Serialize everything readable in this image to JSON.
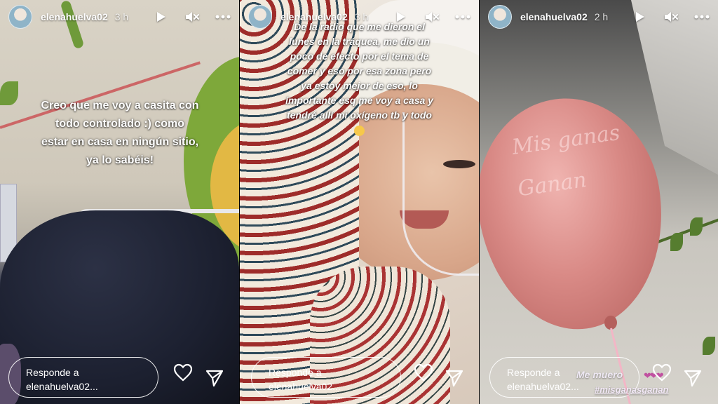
{
  "stories": [
    {
      "username": "elenahuelva02",
      "time": "3 h",
      "caption": "Creo que me voy a casita con\ntodo controlado :) como\nestar en casa en ningún sitio,\nya lo sabéis!",
      "reply_line1": "Responde a",
      "reply_line2": "elenahuelva02..."
    },
    {
      "username": "elenahuelva02",
      "time": "3 h",
      "caption": "De la radio que me dieron el\nlunes  en la tráquea, me dio un\npoco de efecto por el tema de\ncomer y eso por esa zona pero\nya estoy mejor de eso, lo\nimportante esq me voy a casa y\ntendré allí mi oxígeno tb y todo",
      "reply_line1": "Responde a",
      "reply_line2": "elenahuelva02..."
    },
    {
      "username": "elenahuelva02",
      "time": "2 h",
      "balloon_text_1": "Mis ganas",
      "balloon_text_2": "Ganan",
      "sticker_text": "Me muero",
      "hashtag": "#misganasganan",
      "reply_line1": "Responde a",
      "reply_line2": "elenahuelva02..."
    }
  ],
  "icons": {
    "play": "play-icon",
    "mute": "mute-icon",
    "more": "more-icon",
    "like": "heart-icon",
    "send": "send-icon",
    "emoji": "smiling-face-emoji",
    "hearts": "heart-emoji"
  },
  "colors": {
    "text": "#ffffff",
    "hearts": "#c050a0"
  }
}
